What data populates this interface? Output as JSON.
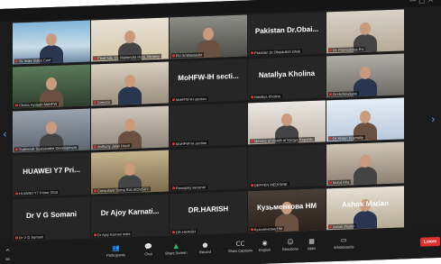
{
  "tiles": [
    {
      "label": "SL India Video Conf",
      "big": ""
    },
    {
      "label": "Chief Adv. Dr. Mahendra Hota, Ministry",
      "big": ""
    },
    {
      "label": "RU Ambassador",
      "big": ""
    },
    {
      "label": "Pakistan Dr.Obaidullah Ohidi",
      "big": "Pakistan Dr.Obai..."
    },
    {
      "label": "Dr. Pramodolya RU",
      "big": ""
    },
    {
      "label": "Chinta Hydgah MoHFW",
      "big": ""
    },
    {
      "label": "Director",
      "big": ""
    },
    {
      "label": "MoHFW-IH section",
      "big": "MoHFW-IH secti..."
    },
    {
      "label": "Natallya Kholina",
      "big": "Natallya Kholina"
    },
    {
      "label": "Dr.Hichowayee",
      "big": ""
    },
    {
      "label": "Subhendr Sustainable Development",
      "big": ""
    },
    {
      "label": "Anthony Jalali Hinch",
      "big": ""
    },
    {
      "label": "MAHFW-IH section",
      "big": ""
    },
    {
      "label": "Ministry of Health of Kyrgyz Republic",
      "big": ""
    },
    {
      "label": "Dr Yerlan Krismaliy",
      "big": ""
    },
    {
      "label": "HUAWEI Y7 Prime 2018",
      "big": "HUAWEI Y7 Pri..."
    },
    {
      "label": "Consultant Soma SULIKOVSKY",
      "big": ""
    },
    {
      "label": "Rossijskij nacional",
      "big": ""
    },
    {
      "label": "DEFPEN MEDISINE",
      "big": ""
    },
    {
      "label": "Mohd Afra",
      "big": ""
    },
    {
      "label": "Dr V G Somani",
      "big": "Dr V G Somani"
    },
    {
      "label": "Dr Ajoy Karnati India",
      "big": "Dr Ajoy  Karnati..."
    },
    {
      "label": "DR.HARISH",
      "big": "DR.HARISH"
    },
    {
      "label": "Кузьменкова НМ",
      "big": "Кузьменкова НМ"
    },
    {
      "label": "Ashok Madan",
      "big": "Ashok Madan"
    }
  ],
  "toolbar": {
    "items": [
      {
        "label": "Participants",
        "icon": "people-icon",
        "glyph": "👥"
      },
      {
        "label": "Chat",
        "icon": "chat-icon",
        "glyph": "💬"
      },
      {
        "label": "Share Screen",
        "icon": "share-screen-icon",
        "glyph": "▲"
      },
      {
        "label": "Record",
        "icon": "record-icon",
        "glyph": "●"
      },
      {
        "label": "Show Captions",
        "icon": "captions-icon",
        "glyph": "CC"
      },
      {
        "label": "English",
        "icon": "globe-icon",
        "glyph": "◉"
      },
      {
        "label": "Reactions",
        "icon": "smile-icon",
        "glyph": "☺"
      },
      {
        "label": "Apps",
        "icon": "apps-icon",
        "glyph": "▦"
      },
      {
        "label": "Whiteboards",
        "icon": "whiteboard-icon",
        "glyph": "▭"
      }
    ],
    "end_label": "Leave",
    "left_label": "ios"
  },
  "colors": {
    "share_accent": "#21c46a",
    "end_red": "#e0302a",
    "mute_red": "#e0302a"
  }
}
